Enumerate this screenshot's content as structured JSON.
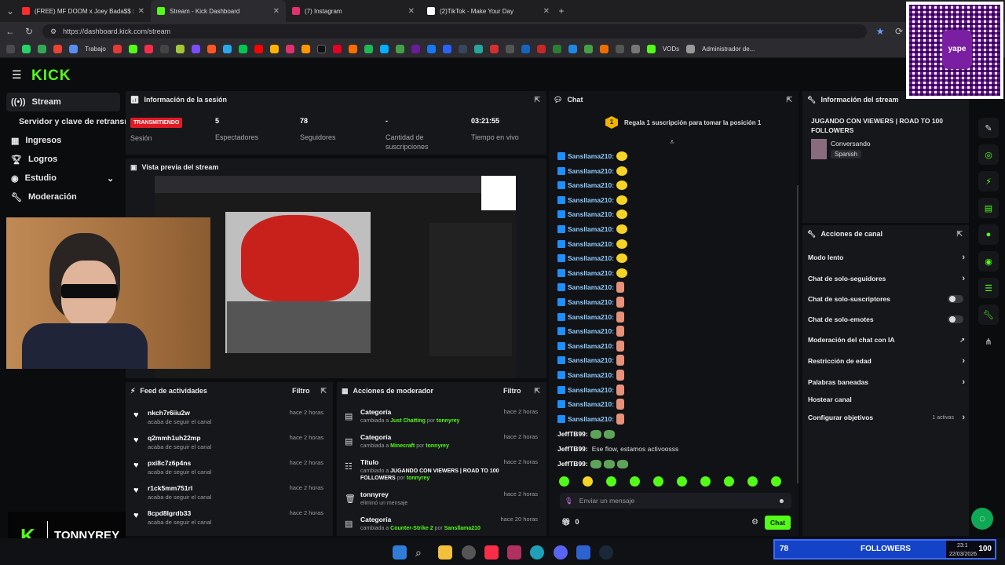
{
  "browser": {
    "tabs": [
      {
        "title": "(FREE) MF DOOM x Joey Bada$$ x",
        "color": "#ff2a2a"
      },
      {
        "title": "Stream - Kick Dashboard",
        "color": "#53fc18"
      },
      {
        "title": "(7) Instagram",
        "color": "#e1306c"
      },
      {
        "title": "(2)TikTok - Make Your Day",
        "color": "#ffffff"
      }
    ],
    "url": "https://dashboard.kick.com/stream",
    "bookmarks": [
      "Trabajo",
      "VODs",
      "Administrador de..."
    ]
  },
  "logo": "KICK",
  "sidebar": {
    "items": [
      {
        "label": "Stream",
        "icon": "broadcast-icon"
      },
      {
        "label": "Servidor y clave de retransm",
        "icon": ""
      },
      {
        "label": "Ingresos",
        "icon": "grid-icon"
      },
      {
        "label": "Logros",
        "icon": "trophy-icon"
      },
      {
        "label": "Estudio",
        "icon": "studio-icon"
      },
      {
        "label": "Moderación",
        "icon": "wrench-icon"
      }
    ]
  },
  "session": {
    "title": "Información de la sesión",
    "status": "TRANSMITIENDO",
    "status_label": "Sesión",
    "viewers_value": "5",
    "viewers_label": "Espectadores",
    "followers_value": "78",
    "followers_label": "Seguidores",
    "subs_value": "-",
    "subs_label": "Cantidad de suscripciones",
    "live_value": "03:21:55",
    "live_label": "Tiempo en vivo"
  },
  "preview": {
    "title": "Vista previa del stream"
  },
  "webcam_name": "TONNYREY",
  "feed": {
    "title": "Feed de actividades",
    "filter": "Filtro",
    "items": [
      {
        "name": "nkch7r6iiu2w",
        "desc": "acaba de seguir el canal",
        "time": "hace 2 horas"
      },
      {
        "name": "q2mmh1uh22mp",
        "desc": "acaba de seguir el canal",
        "time": "hace 2 horas"
      },
      {
        "name": "pxi8c7z6p4ns",
        "desc": "acaba de seguir el canal",
        "time": "hace 2 horas"
      },
      {
        "name": "r1ck5mm751rl",
        "desc": "acaba de seguir el canal",
        "time": "hace 2 horas"
      },
      {
        "name": "8cpd8lgrdb33",
        "desc": "acaba de seguir el canal",
        "time": "hace 2 horas"
      }
    ]
  },
  "mod": {
    "title": "Acciones de moderador",
    "filter": "Filtro",
    "items": [
      {
        "name": "Categoría",
        "pre": "cambiada a ",
        "hl": "Just Chatting",
        "post": " por ",
        "user": "tonnyrey",
        "time": "hace 2 horas"
      },
      {
        "name": "Categoría",
        "pre": "cambiada a ",
        "hl": "Minecraft",
        "post": " por ",
        "user": "tonnyrey",
        "time": "hace 2 horas"
      },
      {
        "name": "Título",
        "pre": "cambiado a ",
        "hl": "JUGANDO CON VIEWERS | ROAD TO 100 FOLLOWERS",
        "post": " por ",
        "user": "tonnyrey",
        "time": "hace 2 horas"
      },
      {
        "name": "tonnyrey",
        "pre": "eliminó un mensaje",
        "hl": "",
        "post": "",
        "user": "",
        "time": "hace 2 horas"
      },
      {
        "name": "Categoría",
        "pre": "cambiada a ",
        "hl": "Counter-Strike 2",
        "post": " por ",
        "user": "Sansllama210",
        "time": "hace 20 horas"
      }
    ]
  },
  "chat": {
    "title": "Chat",
    "promo_rank": "1",
    "promo": "Regala 1 suscripción para tomar la posición 1",
    "user": "Sansllama210:",
    "jeff": "JeffTB99:",
    "jeff_msg": "Ese flow, estamos activoosss",
    "placeholder": "Enviar un mensaje",
    "points": "0",
    "send": "Chat"
  },
  "stream_info": {
    "title": "Información del stream",
    "stream_title": "JUGANDO CON VIEWERS | ROAD TO 100 FOLLOWERS",
    "category": "Conversando",
    "language": "Spanish"
  },
  "channel_actions": {
    "title": "Acciones de canal",
    "items": [
      {
        "label": "Modo lento",
        "type": "arrow"
      },
      {
        "label": "Chat de solo-seguidores",
        "type": "arrow"
      },
      {
        "label": "Chat de solo-suscriptores",
        "type": "toggle"
      },
      {
        "label": "Chat de solo-emotes",
        "type": "toggle"
      },
      {
        "label": "Moderación del chat con IA",
        "type": "ext"
      },
      {
        "label": "Restricción de edad",
        "type": "arrow"
      },
      {
        "label": "Palabras baneadas",
        "type": "arrow"
      },
      {
        "label": "Hostear canal",
        "type": "none"
      },
      {
        "label": "Configurar objetivos",
        "type": "arrow"
      }
    ],
    "goals_active": "1 activas"
  },
  "follower_bar": {
    "count": "78",
    "label": "FOLLOWERS",
    "clock_time": "23:1",
    "clock_date": "22/03/2026",
    "goal": "100"
  },
  "qr": {
    "brand": "yape"
  }
}
